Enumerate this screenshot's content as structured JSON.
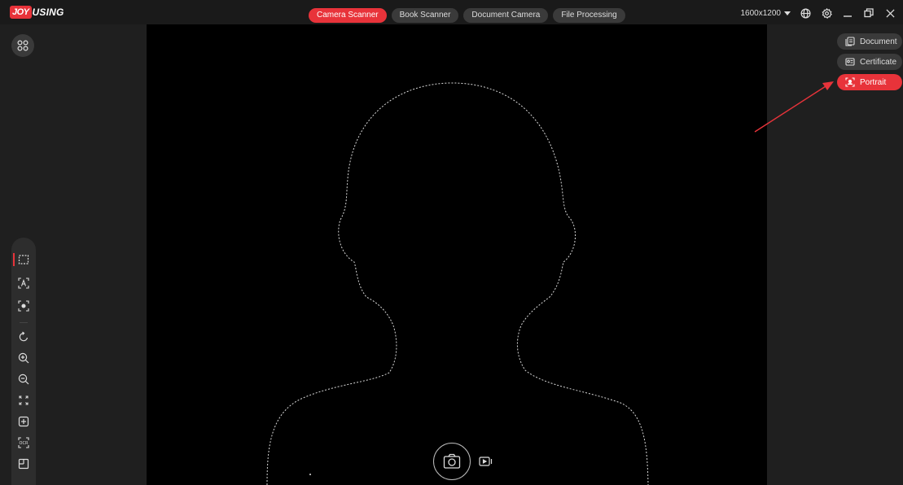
{
  "app": {
    "logo_mark": "JOY",
    "logo_text": "USING"
  },
  "mode_tabs": [
    {
      "label": "Camera Scanner",
      "active": true
    },
    {
      "label": "Book Scanner",
      "active": false
    },
    {
      "label": "Document Camera",
      "active": false
    },
    {
      "label": "File Processing",
      "active": false
    }
  ],
  "controls": {
    "resolution": "1600x1200",
    "icons": [
      "globe-icon",
      "settings-icon",
      "minimize-icon",
      "restore-icon",
      "close-icon"
    ]
  },
  "left_toolbar": {
    "tools": [
      "crop-auto-icon",
      "crop-text-icon",
      "crop-center-icon",
      "rotate-icon",
      "zoom-in-icon",
      "zoom-out-icon",
      "fit-screen-icon",
      "focus-icon",
      "ocr-icon",
      "layout-icon"
    ]
  },
  "scene_modes": [
    {
      "label": "Document",
      "icon": "document-icon",
      "active": false
    },
    {
      "label": "Certificate",
      "icon": "certificate-icon",
      "active": false
    },
    {
      "label": "Portrait",
      "icon": "portrait-icon",
      "active": true
    }
  ],
  "colors": {
    "accent": "#e8333a",
    "panel": "#1f1f1f",
    "viewport": "#000000",
    "button": "#3a3a3a"
  }
}
